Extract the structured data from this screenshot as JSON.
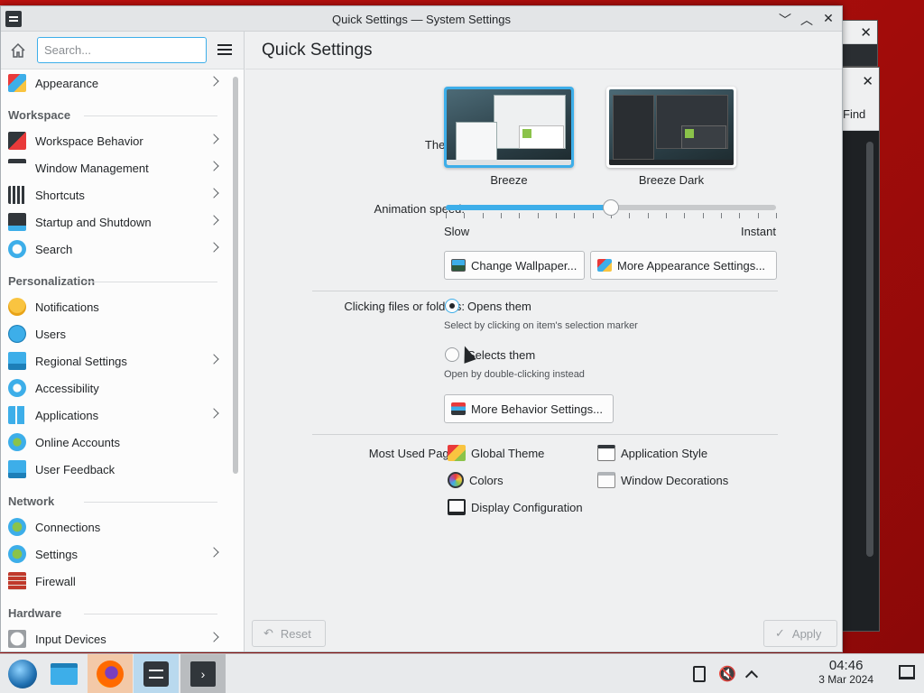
{
  "window": {
    "title": "Quick Settings — System Settings",
    "controls": {
      "minimize": "﹀",
      "maximize": "︿",
      "close": "✕"
    }
  },
  "background_window": {
    "find_label": "Find",
    "close": "✕"
  },
  "sidebar": {
    "search_placeholder": "Search...",
    "top_item": {
      "label": "Appearance"
    },
    "sections": [
      {
        "title": "Workspace",
        "items": [
          {
            "label": "Workspace Behavior",
            "chevron": true
          },
          {
            "label": "Window Management",
            "chevron": true
          },
          {
            "label": "Shortcuts",
            "chevron": true
          },
          {
            "label": "Startup and Shutdown",
            "chevron": true
          },
          {
            "label": "Search",
            "chevron": true
          }
        ]
      },
      {
        "title": "Personalization",
        "items": [
          {
            "label": "Notifications",
            "chevron": false
          },
          {
            "label": "Users",
            "chevron": false
          },
          {
            "label": "Regional Settings",
            "chevron": true
          },
          {
            "label": "Accessibility",
            "chevron": false
          },
          {
            "label": "Applications",
            "chevron": true
          },
          {
            "label": "Online Accounts",
            "chevron": false
          },
          {
            "label": "User Feedback",
            "chevron": false
          }
        ]
      },
      {
        "title": "Network",
        "items": [
          {
            "label": "Connections",
            "chevron": false
          },
          {
            "label": "Settings",
            "chevron": true
          },
          {
            "label": "Firewall",
            "chevron": false
          }
        ]
      },
      {
        "title": "Hardware",
        "items": [
          {
            "label": "Input Devices",
            "chevron": true
          }
        ]
      }
    ]
  },
  "main": {
    "page_title": "Quick Settings",
    "theme": {
      "label": "Theme:",
      "options": [
        {
          "name": "Breeze",
          "selected": true
        },
        {
          "name": "Breeze Dark",
          "selected": false
        }
      ]
    },
    "animation": {
      "label": "Animation speed:",
      "min_label": "Slow",
      "max_label": "Instant",
      "value_fraction": 0.5
    },
    "buttons": {
      "change_wallpaper": "Change Wallpaper...",
      "more_appearance": "More Appearance Settings...",
      "more_behavior": "More Behavior Settings..."
    },
    "clicking": {
      "label": "Clicking files or folders:",
      "opt1": "Opens them",
      "opt1_hint": "Select by clicking on item's selection marker",
      "opt2": "Selects them",
      "opt2_hint": "Open by double-clicking instead",
      "selected": "opt1"
    },
    "most_used": {
      "label": "Most Used Pages:",
      "pages": [
        "Global Theme",
        "Application Style",
        "Colors",
        "Window Decorations",
        "Display Configuration"
      ]
    },
    "reset": "Reset",
    "apply": "Apply"
  },
  "taskbar": {
    "time": "04:46",
    "date": "3 Mar 2024"
  },
  "colors": {
    "accent": "#3daee9",
    "desktop": "#b8100e"
  }
}
